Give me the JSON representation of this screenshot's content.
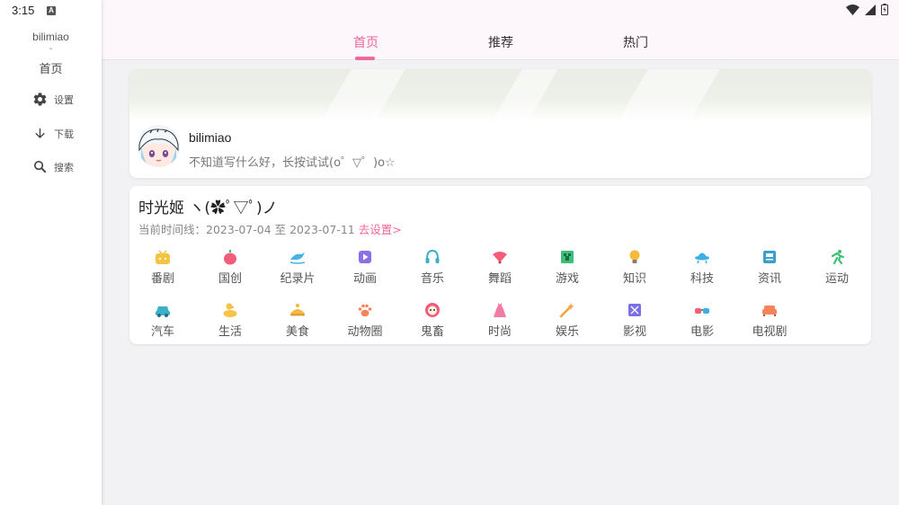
{
  "status_bar": {
    "time": "3:15",
    "notif_letter": "A"
  },
  "sidebar": {
    "username": "bilimiao",
    "separator": "-",
    "current_page": "首页",
    "items": [
      {
        "label": "设置",
        "icon": "gear-icon"
      },
      {
        "label": "下载",
        "icon": "download-icon"
      },
      {
        "label": "搜索",
        "icon": "search-icon"
      }
    ]
  },
  "tabs": [
    {
      "label": "首页",
      "active": true
    },
    {
      "label": "推荐",
      "active": false
    },
    {
      "label": "热门",
      "active": false
    }
  ],
  "profile": {
    "name": "bilimiao",
    "signature": "不知道写什么好，长按试试(o゜▽゜)o☆"
  },
  "timeline": {
    "title": "时光姬 ヽ(✿ﾟ▽ﾟ)ノ",
    "range_prefix": "当前时间线：",
    "range": "2023-07-04 至 2023-07-11",
    "set_link": "去设置>",
    "categories": [
      {
        "label": "番剧",
        "icon": "tv-icon",
        "color": "#f6c343"
      },
      {
        "label": "国创",
        "icon": "lantern-icon",
        "color": "#f25d79"
      },
      {
        "label": "纪录片",
        "icon": "dolphin-icon",
        "color": "#47b3e6"
      },
      {
        "label": "动画",
        "icon": "play-icon",
        "color": "#8a6fe6"
      },
      {
        "label": "音乐",
        "icon": "headphones-icon",
        "color": "#3ab0c9"
      },
      {
        "label": "舞蹈",
        "icon": "fan-icon",
        "color": "#f25d79"
      },
      {
        "label": "游戏",
        "icon": "creeper-icon",
        "color": "#3dbf7a"
      },
      {
        "label": "知识",
        "icon": "bulb-icon",
        "color": "#f6b93b"
      },
      {
        "label": "科技",
        "icon": "ufo-icon",
        "color": "#3ab0e6"
      },
      {
        "label": "资讯",
        "icon": "news-icon",
        "color": "#3aa0c9"
      },
      {
        "label": "运动",
        "icon": "runner-icon",
        "color": "#3dbf7a"
      },
      {
        "label": "汽车",
        "icon": "car-icon",
        "color": "#3ab0c9"
      },
      {
        "label": "生活",
        "icon": "duck-icon",
        "color": "#f6c343"
      },
      {
        "label": "美食",
        "icon": "food-icon",
        "color": "#f6b93b"
      },
      {
        "label": "动物圈",
        "icon": "paw-icon",
        "color": "#f5845c"
      },
      {
        "label": "鬼畜",
        "icon": "ghost-icon",
        "color": "#f25d79"
      },
      {
        "label": "时尚",
        "icon": "dress-icon",
        "color": "#f17ba6"
      },
      {
        "label": "娱乐",
        "icon": "wand-icon",
        "color": "#f6a13b"
      },
      {
        "label": "影视",
        "icon": "film-icon",
        "color": "#7a6fe6"
      },
      {
        "label": "电影",
        "icon": "3d-glasses-icon",
        "color": "#f25d79"
      },
      {
        "label": "电视剧",
        "icon": "sofa-icon",
        "color": "#f5845c"
      }
    ]
  },
  "colors": {
    "accent": "#f0679a",
    "header_bg": "#fdf6fa",
    "page_bg": "#f2f2f5"
  }
}
